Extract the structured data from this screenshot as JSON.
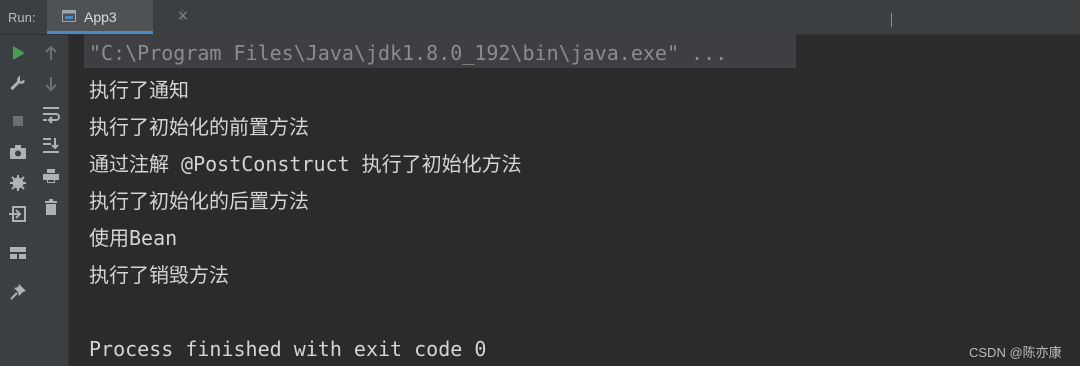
{
  "topbar": {
    "run_label": "Run:",
    "tab_label": "App3",
    "tab_close": "×"
  },
  "console": {
    "command": "\"C:\\Program Files\\Java\\jdk1.8.0_192\\bin\\java.exe\" ...",
    "lines": [
      "执行了通知",
      "执行了初始化的前置方法",
      "通过注解 @PostConstruct 执行了初始化方法",
      "执行了初始化的后置方法",
      "使用Bean",
      "执行了销毁方法"
    ],
    "exit": "Process finished with exit code 0"
  },
  "watermark": "CSDN @陈亦康",
  "icons": {
    "gutter1": [
      "run-icon",
      "wrench-icon",
      "stop-icon",
      "camera-icon",
      "settings-bug-icon",
      "exit-icon",
      "layout-icon",
      "pin-icon"
    ],
    "gutter2": [
      "arrow-up-icon",
      "arrow-down-icon",
      "soft-wrap-icon",
      "scroll-to-end-icon",
      "print-icon",
      "trash-icon"
    ]
  },
  "colors": {
    "background": "#2b2b2b",
    "run_green": "#499c54",
    "tab_underline": "#4a88c7"
  }
}
